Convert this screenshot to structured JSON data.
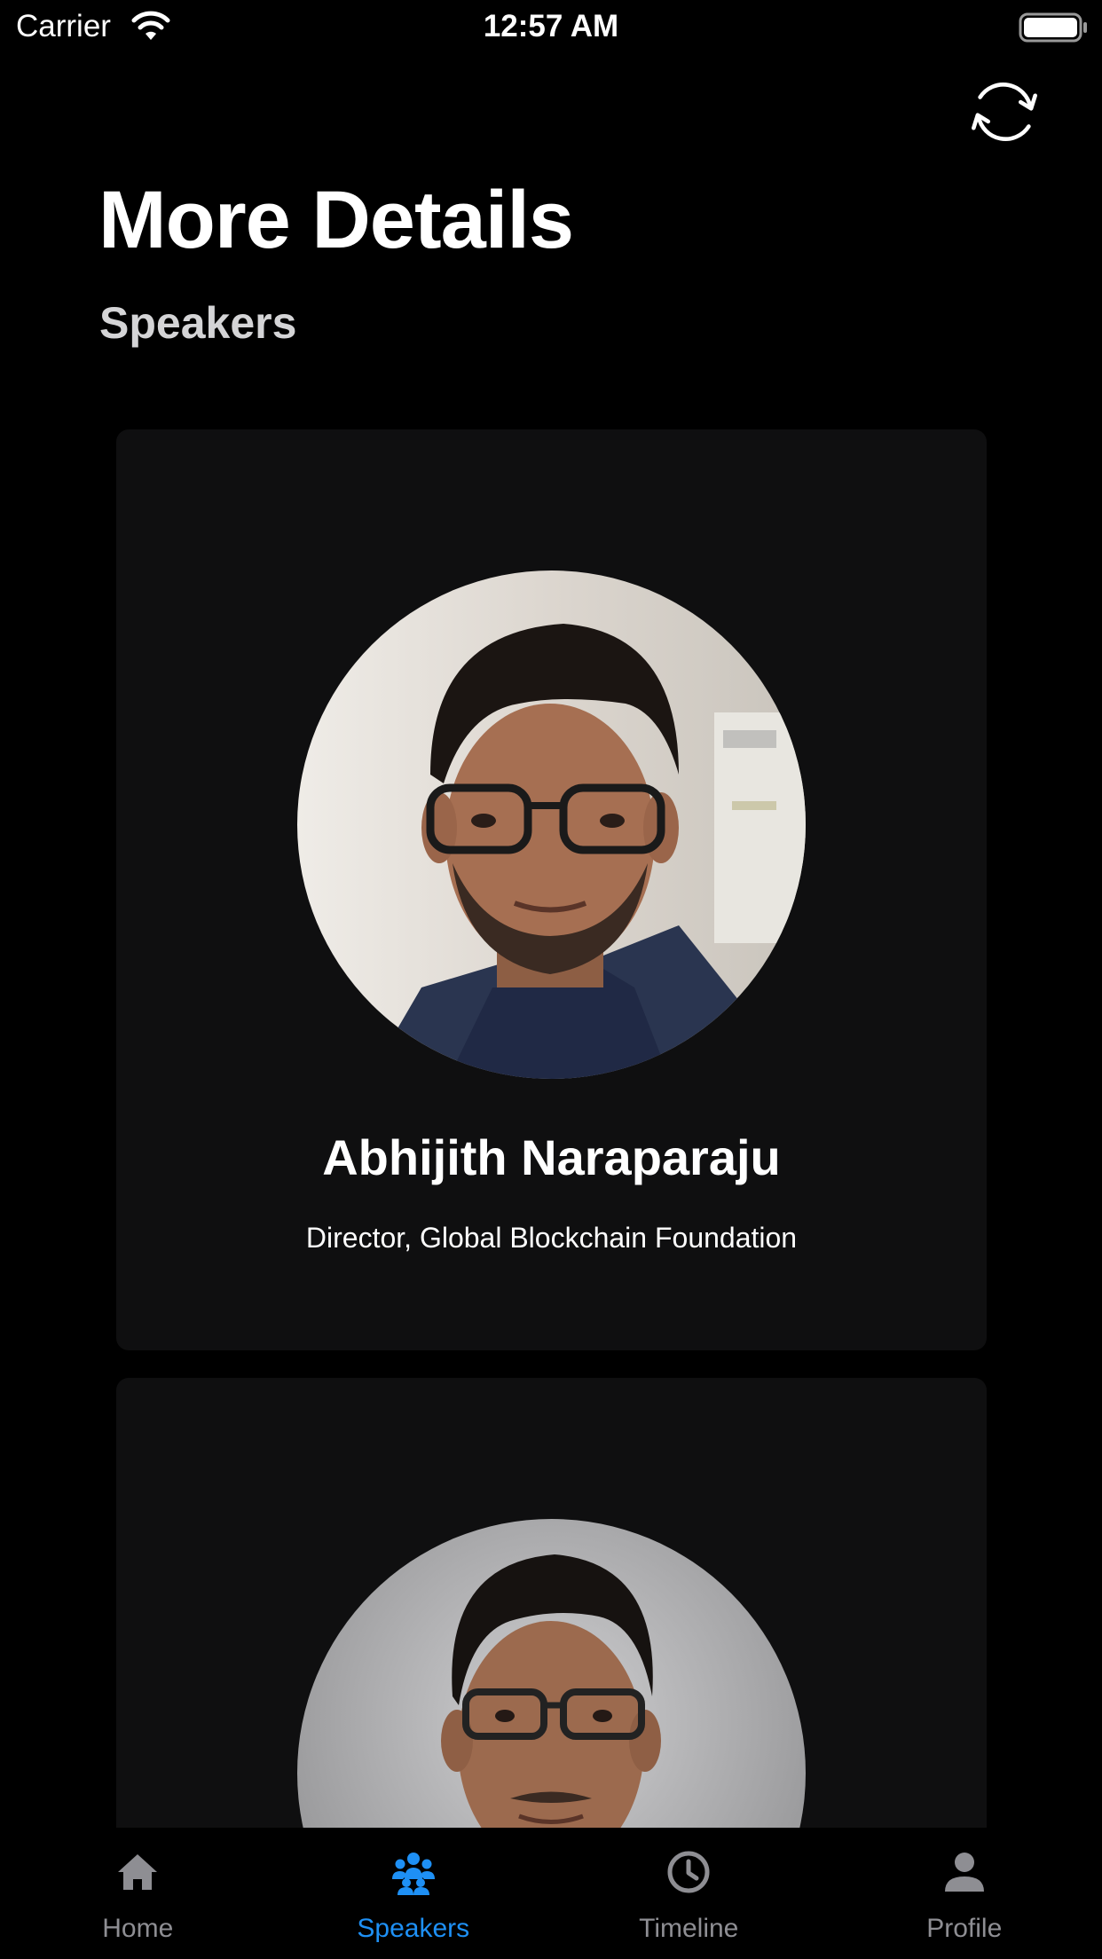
{
  "status_bar": {
    "carrier": "Carrier",
    "time": "12:57 AM",
    "wifi_icon": "wifi-icon",
    "battery_icon": "battery-full-icon"
  },
  "header": {
    "title": "More Details",
    "subtitle": "Speakers",
    "refresh_icon": "refresh-icon"
  },
  "speakers": [
    {
      "name": "Abhijith Naraparaju",
      "role": "Director, Global Blockchain Foundation",
      "avatar": "speaker-photo"
    },
    {
      "name": "",
      "role": "",
      "avatar": "speaker-photo"
    }
  ],
  "tabs": [
    {
      "label": "Home",
      "icon": "home-icon",
      "active": false
    },
    {
      "label": "Speakers",
      "icon": "people-icon",
      "active": true
    },
    {
      "label": "Timeline",
      "icon": "clock-icon",
      "active": false
    },
    {
      "label": "Profile",
      "icon": "person-icon",
      "active": false
    }
  ],
  "colors": {
    "background": "#000000",
    "card": "#0f0f10",
    "accent": "#1e90f5",
    "inactive_tab": "#8e8e93",
    "subtitle": "#d4d4d6"
  }
}
